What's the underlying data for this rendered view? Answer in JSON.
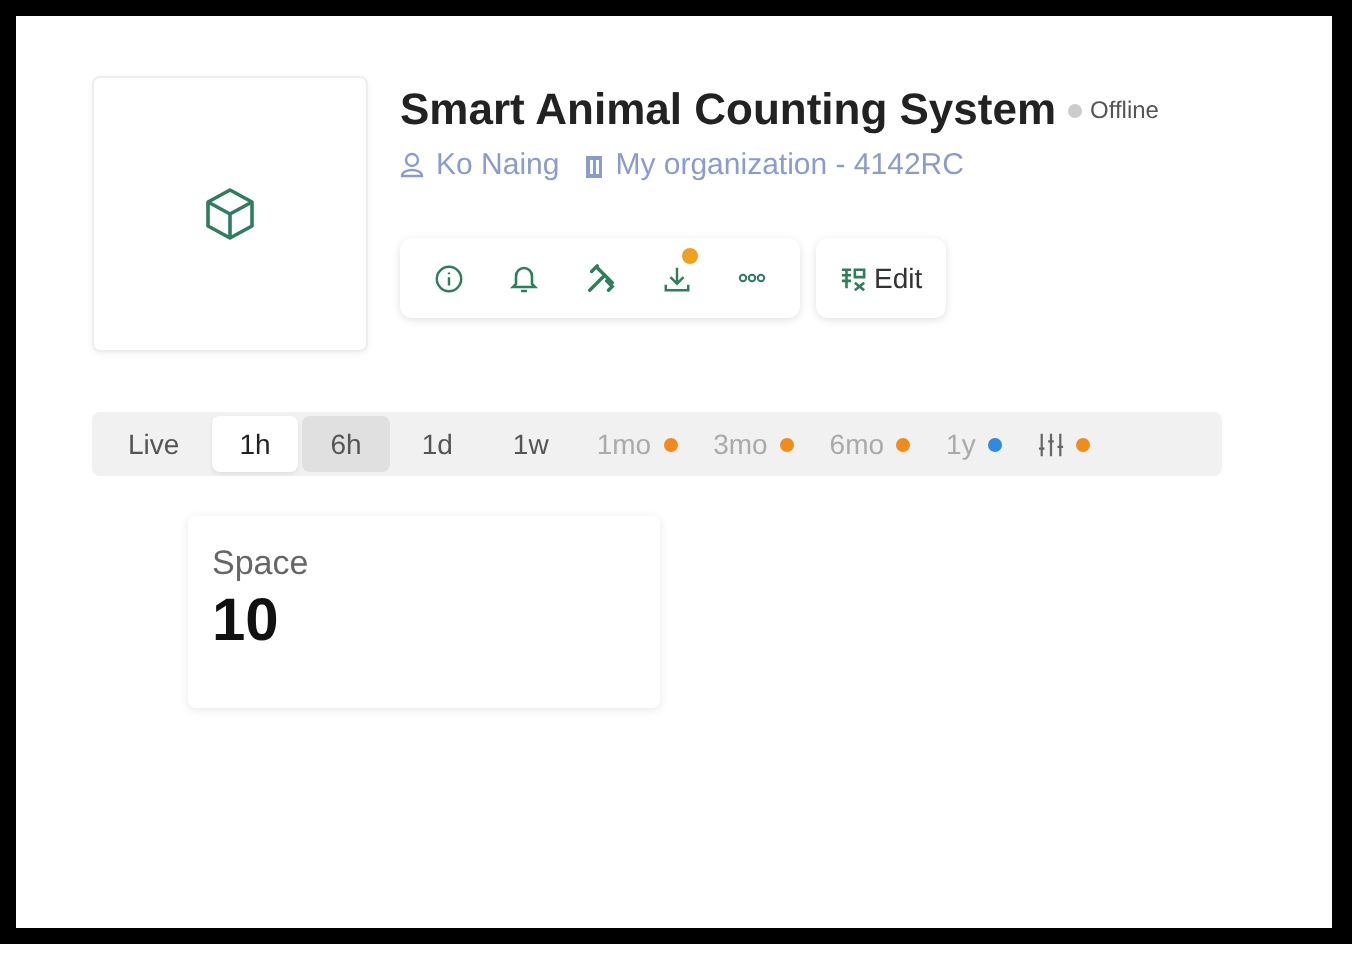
{
  "device": {
    "title": "Smart Animal Counting System",
    "status": {
      "label": "Offline",
      "online": false
    },
    "owner": "Ko Naing",
    "organization": "My organization - 4142RC"
  },
  "toolbar": [
    {
      "kind": "info"
    },
    {
      "kind": "bell"
    },
    {
      "kind": "tools"
    },
    {
      "kind": "download",
      "color": "#f0a020"
    },
    {
      "kind": "more"
    }
  ],
  "edit_button": {
    "label": "Edit"
  },
  "ranges": [
    {
      "kind": "text",
      "label": "Live",
      "selected": false,
      "hovered": false,
      "disabled": false
    },
    {
      "kind": "text",
      "label": "1h",
      "selected": true,
      "hovered": false,
      "disabled": false
    },
    {
      "kind": "text",
      "label": "6h",
      "selected": false,
      "hovered": true,
      "disabled": false
    },
    {
      "kind": "text",
      "label": "1d",
      "selected": false,
      "hovered": false,
      "disabled": false
    },
    {
      "kind": "text",
      "label": "1w",
      "selected": false,
      "hovered": false,
      "disabled": false
    },
    {
      "kind": "text",
      "label": "1mo",
      "selected": false,
      "hovered": false,
      "disabled": true,
      "color": "#f08c1e"
    },
    {
      "kind": "text",
      "label": "3mo",
      "selected": false,
      "hovered": false,
      "disabled": true,
      "color": "#f08c1e"
    },
    {
      "kind": "text",
      "label": "6mo",
      "selected": false,
      "hovered": false,
      "disabled": true,
      "color": "#f08c1e"
    },
    {
      "kind": "text",
      "label": "1y",
      "selected": false,
      "hovered": false,
      "disabled": true,
      "color": "#2f8be0"
    },
    {
      "kind": "icon",
      "selected": false,
      "hovered": false,
      "disabled": true,
      "color": "#f08c1e"
    }
  ],
  "widgets": [
    {
      "label": "Space",
      "value": "10"
    }
  ]
}
